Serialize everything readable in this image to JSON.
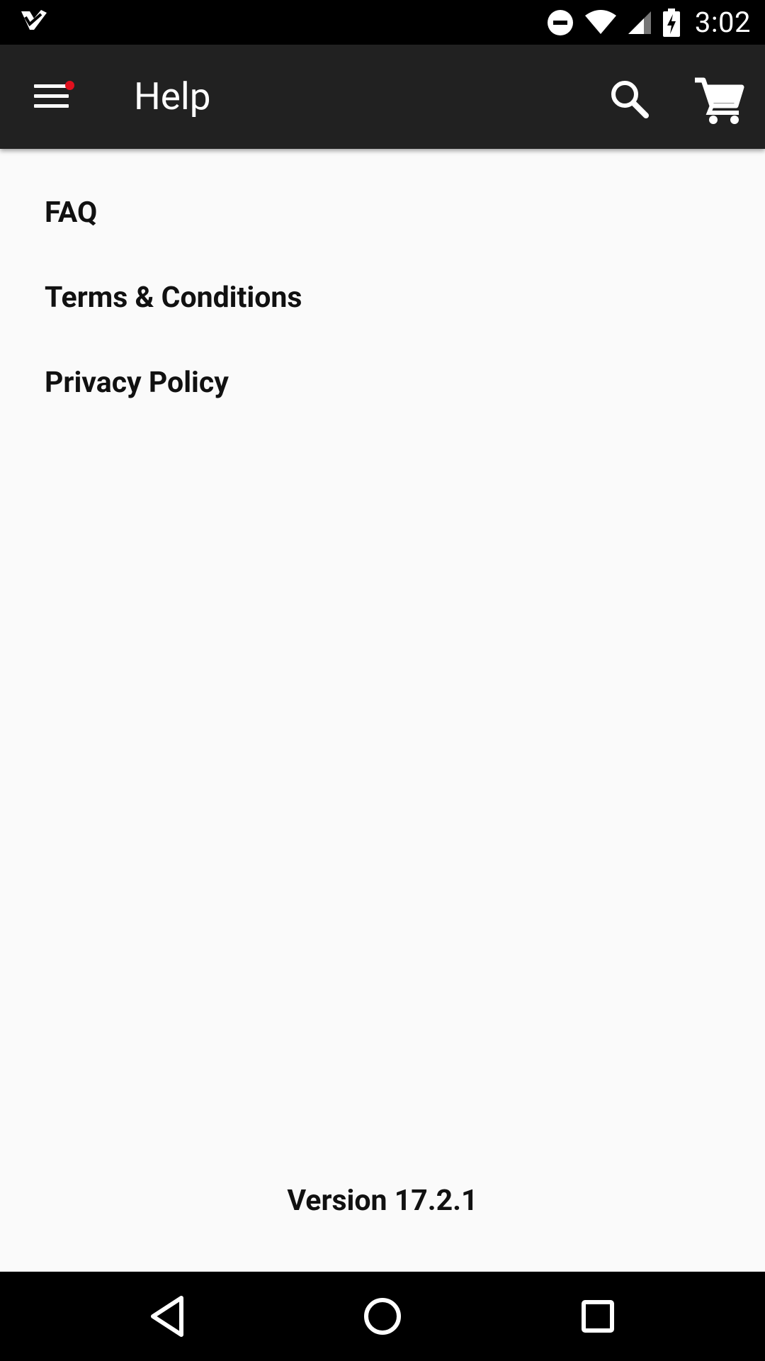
{
  "status_bar": {
    "time": "3:02",
    "icons": [
      "app-notification-icon",
      "do-not-disturb-icon",
      "wifi-icon",
      "cell-signal-icon",
      "battery-charging-icon"
    ]
  },
  "app_bar": {
    "title": "Help",
    "menu_icon": "hamburger-menu-icon",
    "search_icon": "search-icon",
    "cart_icon": "cart-icon",
    "background": "#212121",
    "badge_color": "#e0101e"
  },
  "menu": {
    "items": [
      {
        "label": "FAQ"
      },
      {
        "label": "Terms & Conditions"
      },
      {
        "label": "Privacy Policy"
      }
    ]
  },
  "footer": {
    "version": "Version 17.2.1"
  },
  "nav_bar": {
    "back_icon": "back-triangle-icon",
    "home_icon": "home-circle-icon",
    "recents_icon": "recents-square-icon"
  }
}
